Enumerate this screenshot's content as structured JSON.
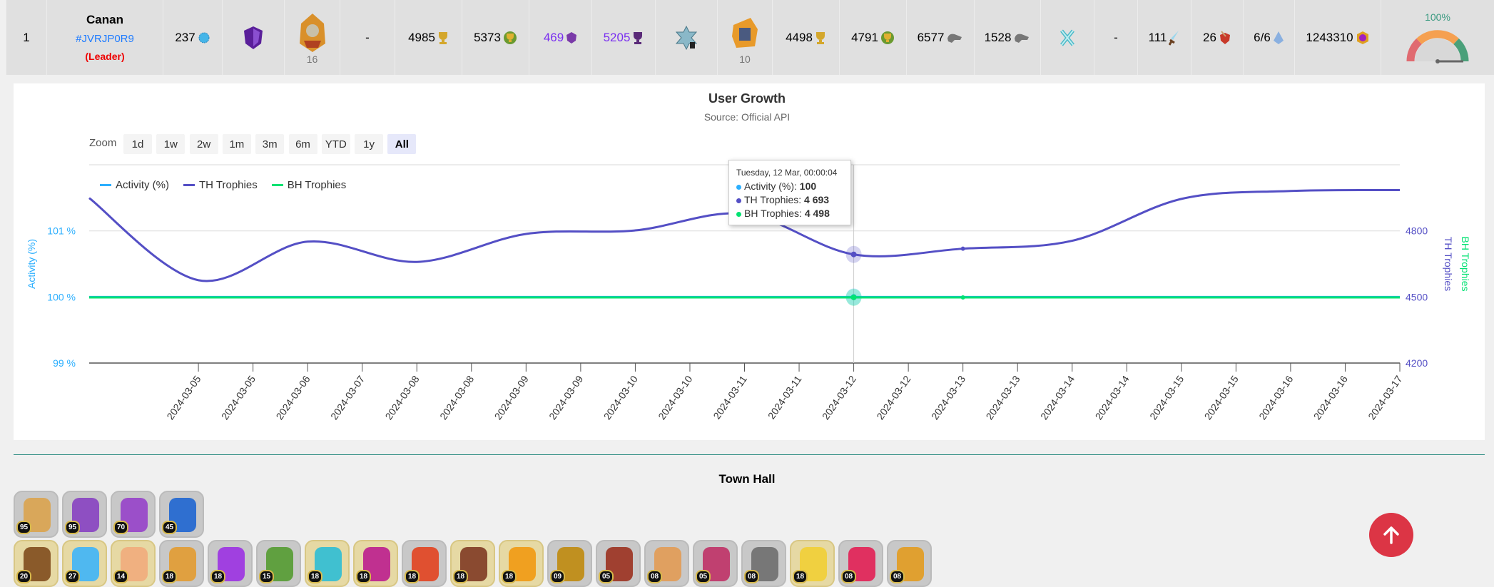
{
  "player": {
    "rank": "1",
    "name": "Canan",
    "tag": "#JVRJP0R9",
    "role": "(Leader)",
    "exp_level": "237",
    "exp_icon": "xp-star-icon",
    "league_icon": "legend-league-shield-icon",
    "town_hall_level": "16",
    "town_hall_icon": "town-hall-icon",
    "war_preference": "-",
    "trophies": "4985",
    "best_trophies": "5373",
    "legend_trophies": "469",
    "best_legend_trophies": "5205",
    "builder_league_icon": "builder-league-icon",
    "builder_hall_level": "10",
    "builder_trophies": "4498",
    "best_builder_trophies": "4791",
    "donations": "6577",
    "received": "1528",
    "war_league_icon": "war-league-icon",
    "war_stars": "-",
    "attack_wins": "111",
    "defense_wins": "26",
    "clan_capital": "6/6",
    "capital_contributions": "1243310",
    "activity": "100%",
    "activity_level": 1.0
  },
  "chart_data": {
    "type": "line",
    "title": "User Growth",
    "subtitle": "Source: Official API",
    "zoom_label": "Zoom",
    "zoom_buttons": [
      "1d",
      "1w",
      "2w",
      "1m",
      "3m",
      "6m",
      "YTD",
      "1y",
      "All"
    ],
    "zoom_selected": "All",
    "x_tick_labels": [
      "2024-03-05",
      "2024-03-05",
      "2024-03-06",
      "2024-03-07",
      "2024-03-08",
      "2024-03-08",
      "2024-03-09",
      "2024-03-09",
      "2024-03-10",
      "2024-03-10",
      "2024-03-11",
      "2024-03-11",
      "2024-03-12",
      "2024-03-12",
      "2024-03-13",
      "2024-03-13",
      "2024-03-14",
      "2024-03-14",
      "2024-03-15",
      "2024-03-15",
      "2024-03-16",
      "2024-03-16",
      "2024-03-17"
    ],
    "xlim": [
      "2024-03-05",
      "2024-03-17"
    ],
    "y_left": {
      "label": "Activity (%)",
      "ticks": [
        "99 %",
        "100 %",
        "101 %"
      ],
      "range": [
        99,
        102
      ],
      "color": "#2caffe"
    },
    "y_right": {
      "labels": [
        "TH Trophies",
        "BH Trophies"
      ],
      "ticks": [
        "4200",
        "4500",
        "4800"
      ],
      "range": [
        4200,
        5100
      ],
      "colors": [
        "#544fc5",
        "#00e272"
      ]
    },
    "x": [
      "2024-03-05",
      "2024-03-06",
      "2024-03-07",
      "2024-03-08",
      "2024-03-09",
      "2024-03-10",
      "2024-03-11",
      "2024-03-12",
      "2024-03-13",
      "2024-03-14",
      "2024-03-15",
      "2024-03-16",
      "2024-03-17"
    ],
    "series": [
      {
        "name": "Activity (%)",
        "axis": "left",
        "color": "#2caffe",
        "values": [
          100,
          100,
          100,
          100,
          100,
          100,
          100,
          100,
          100,
          100,
          100,
          100,
          100
        ]
      },
      {
        "name": "TH Trophies",
        "axis": "right",
        "color": "#544fc5",
        "values": [
          4949,
          4576,
          4751,
          4659,
          4786,
          4802,
          4877,
          4693,
          4719,
          4755,
          4945,
          4981,
          4985
        ]
      },
      {
        "name": "BH Trophies",
        "axis": "right",
        "color": "#00e272",
        "values": [
          4498,
          4498,
          4498,
          4498,
          4498,
          4498,
          4498,
          4498,
          4498,
          4498,
          4498,
          4498,
          4498
        ]
      }
    ],
    "grid": true,
    "legend": "top-left",
    "tooltip": {
      "date": "Tuesday, 12 Mar, 00:00:04",
      "rows": [
        {
          "label": "Activity (%): ",
          "value": "100"
        },
        {
          "label": "TH Trophies: ",
          "value": "4 693"
        },
        {
          "label": "BH Trophies: ",
          "value": "4 498"
        }
      ]
    }
  },
  "town_hall": {
    "title": "Town Hall",
    "heroes": [
      {
        "name": "barbarian-king",
        "level": "95",
        "color": "#d9a75a"
      },
      {
        "name": "archer-queen",
        "level": "95",
        "color": "#8e4fc2"
      },
      {
        "name": "grand-warden",
        "level": "70",
        "color": "#9b4fc9"
      },
      {
        "name": "royal-champion",
        "level": "45",
        "color": "#2f6fd0"
      }
    ],
    "equipment": [
      {
        "level": "20",
        "rarity": "epic",
        "color": "#8a5a2a"
      },
      {
        "level": "27",
        "rarity": "epic",
        "color": "#4fb8f0"
      },
      {
        "level": "14",
        "rarity": "epic",
        "color": "#f0b080"
      },
      {
        "level": "18",
        "rarity": "common",
        "color": "#e0a040"
      },
      {
        "level": "18",
        "rarity": "common",
        "color": "#a040e0"
      },
      {
        "level": "15",
        "rarity": "common",
        "color": "#60a040"
      },
      {
        "level": "18",
        "rarity": "epic",
        "color": "#40c0d0"
      },
      {
        "level": "18",
        "rarity": "epic",
        "color": "#c03090"
      },
      {
        "level": "18",
        "rarity": "common",
        "color": "#e05030"
      },
      {
        "level": "18",
        "rarity": "epic",
        "color": "#8a4a30"
      },
      {
        "level": "18",
        "rarity": "epic",
        "color": "#f0a020"
      },
      {
        "level": "09",
        "rarity": "common",
        "color": "#c09020"
      },
      {
        "level": "05",
        "rarity": "common",
        "color": "#a04030"
      },
      {
        "level": "08",
        "rarity": "common",
        "color": "#e0a060"
      },
      {
        "level": "05",
        "rarity": "common",
        "color": "#c04070"
      },
      {
        "level": "08",
        "rarity": "common",
        "color": "#777777"
      },
      {
        "level": "18",
        "rarity": "epic",
        "color": "#f0d040"
      },
      {
        "level": "08",
        "rarity": "common",
        "color": "#e03060"
      },
      {
        "level": "08",
        "rarity": "common",
        "color": "#e0a030"
      }
    ]
  },
  "scroll_top_icon": "arrow-up-icon"
}
